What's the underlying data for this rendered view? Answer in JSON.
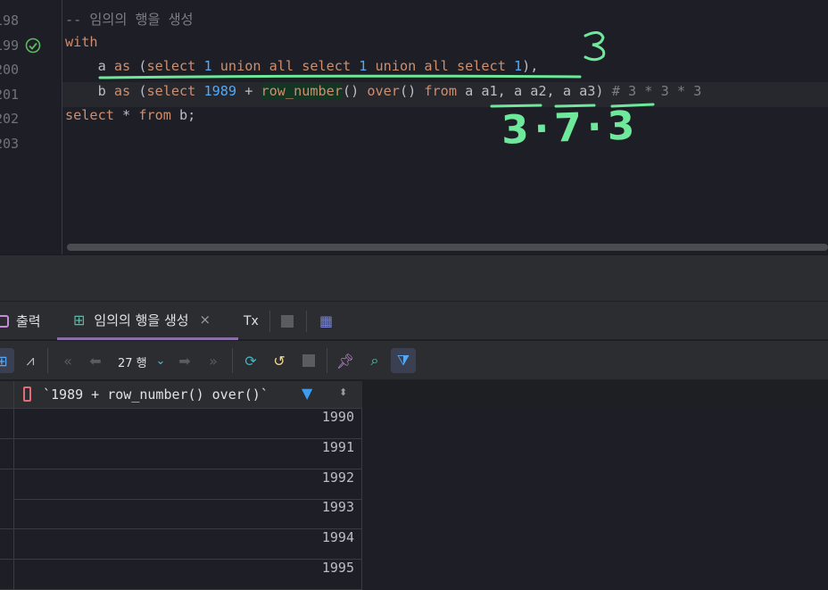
{
  "editor": {
    "line_numbers": [
      "198",
      "199",
      "200",
      "201",
      "202",
      "203"
    ],
    "lines": [
      [
        [
          "cm",
          "-- 임의의 행을 생성"
        ]
      ],
      [
        [
          "kw",
          "with"
        ]
      ],
      [
        [
          "id",
          "    a "
        ],
        [
          "kw",
          "as"
        ],
        [
          "id",
          " ("
        ],
        [
          "kw",
          "select "
        ],
        [
          "num",
          "1"
        ],
        [
          "kw",
          " union all select "
        ],
        [
          "num",
          "1"
        ],
        [
          "kw",
          " union all select "
        ],
        [
          "num",
          "1"
        ],
        [
          "id",
          "),"
        ]
      ],
      [
        [
          "id",
          "    b "
        ],
        [
          "kw",
          "as"
        ],
        [
          "id",
          " ("
        ],
        [
          "kw",
          "select "
        ],
        [
          "num",
          "1989"
        ],
        [
          "id",
          " + "
        ],
        [
          "fn",
          "row_number"
        ],
        [
          "id",
          "() "
        ],
        [
          "kw",
          "over"
        ],
        [
          "id",
          "() "
        ],
        [
          "kw",
          "from"
        ],
        [
          "id",
          " a a1, a a2, a a3) "
        ],
        [
          "cm",
          "# 3 * 3 * 3"
        ]
      ],
      [
        [
          "kw",
          "select"
        ],
        [
          "id",
          " * "
        ],
        [
          "kw",
          "from"
        ],
        [
          "id",
          " b;"
        ]
      ],
      []
    ],
    "annotations": [
      "3",
      "3·7·3"
    ],
    "annotation_color": "#6ee89a"
  },
  "results": {
    "tabs": [
      {
        "label": "출력",
        "icon": "output-icon"
      },
      {
        "label": "임의의 행을 생성",
        "icon": "table-icon",
        "active": true
      }
    ],
    "tx_label": "Tx",
    "row_count": "27 행",
    "column_header": "`1989 + row_number() over()`",
    "rows": [
      "1990",
      "1991",
      "1992",
      "1993",
      "1994",
      "1995"
    ]
  }
}
